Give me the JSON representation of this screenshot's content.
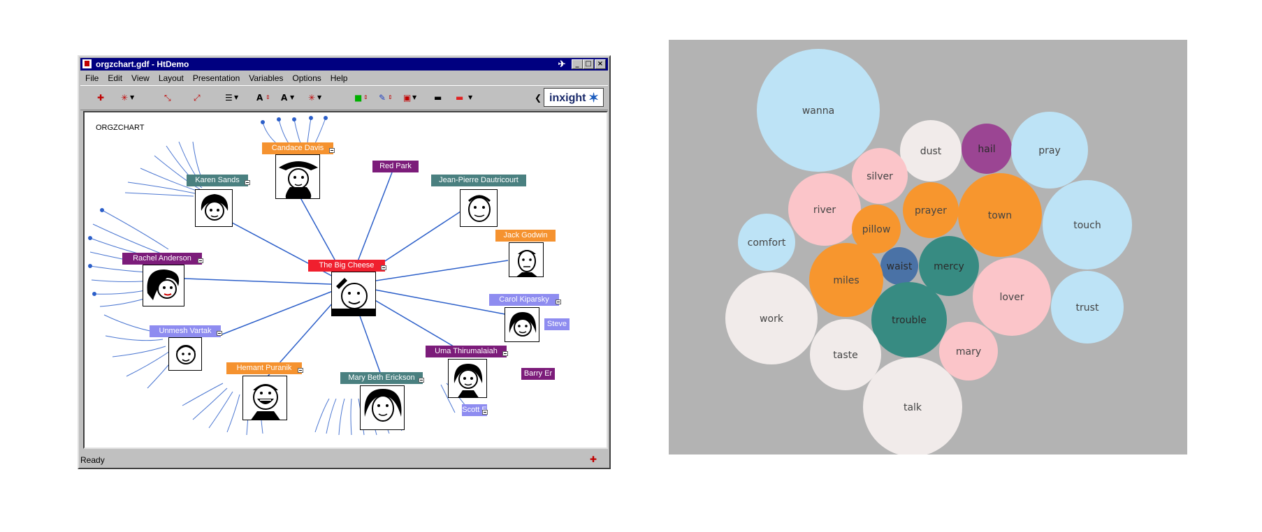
{
  "window": {
    "title": "orgzchart.gdf - HtDemo",
    "menu": [
      "File",
      "Edit",
      "View",
      "Layout",
      "Presentation",
      "Variables",
      "Options",
      "Help"
    ],
    "logo_text": "inxight",
    "status": "Ready"
  },
  "canvas": {
    "title": "ORGZCHART",
    "center": {
      "name": "The Big Cheese",
      "color": "#f01f2e"
    },
    "nodes": [
      {
        "name": "Candace Davis",
        "color": "#f5922f",
        "face": true
      },
      {
        "name": "Red Park",
        "color": "#7c1c7a",
        "face": false
      },
      {
        "name": "Jean-Pierre Dautricourt",
        "color": "#4a8080",
        "face": true
      },
      {
        "name": "Karen Sands",
        "color": "#4a8080",
        "face": true
      },
      {
        "name": "Jack Godwin",
        "color": "#f5922f",
        "face": true
      },
      {
        "name": "Rachel Anderson",
        "color": "#7c1c7a",
        "face": true
      },
      {
        "name": "Carol Kiparsky",
        "color": "#8e8cf0",
        "face": true
      },
      {
        "name": "Steve",
        "color": "#8e8cf0",
        "face": false
      },
      {
        "name": "Unmesh Vartak",
        "color": "#8e8cf0",
        "face": true
      },
      {
        "name": "Uma Thirumalaiah",
        "color": "#7c1c7a",
        "face": true
      },
      {
        "name": "Barry Er",
        "color": "#7c1c7a",
        "face": false
      },
      {
        "name": "Hemant Puranik",
        "color": "#f5922f",
        "face": true
      },
      {
        "name": "Mary Beth Erickson",
        "color": "#4a8080",
        "face": true
      },
      {
        "name": "Scott E",
        "color": "#8e8cf0",
        "face": false
      }
    ]
  },
  "chart_data": {
    "type": "bubble",
    "bubbles": [
      {
        "label": "wanna",
        "color": "#bde3f6"
      },
      {
        "label": "dust",
        "color": "#f1ebea"
      },
      {
        "label": "hail",
        "color": "#9b4593"
      },
      {
        "label": "pray",
        "color": "#bde3f6"
      },
      {
        "label": "silver",
        "color": "#fbc5c9"
      },
      {
        "label": "river",
        "color": "#fbc5c9"
      },
      {
        "label": "prayer",
        "color": "#f7962e"
      },
      {
        "label": "town",
        "color": "#f7962e"
      },
      {
        "label": "touch",
        "color": "#bde3f6"
      },
      {
        "label": "pillow",
        "color": "#f7962e"
      },
      {
        "label": "comfort",
        "color": "#bde3f6"
      },
      {
        "label": "waist",
        "color": "#4a72a6"
      },
      {
        "label": "mercy",
        "color": "#378b82"
      },
      {
        "label": "miles",
        "color": "#f7962e"
      },
      {
        "label": "lover",
        "color": "#fbc5c9"
      },
      {
        "label": "trust",
        "color": "#bde3f6"
      },
      {
        "label": "work",
        "color": "#f1ebea"
      },
      {
        "label": "trouble",
        "color": "#378b82"
      },
      {
        "label": "taste",
        "color": "#f1ebea"
      },
      {
        "label": "mary",
        "color": "#fbc5c9"
      },
      {
        "label": "talk",
        "color": "#f1ebea"
      }
    ]
  }
}
